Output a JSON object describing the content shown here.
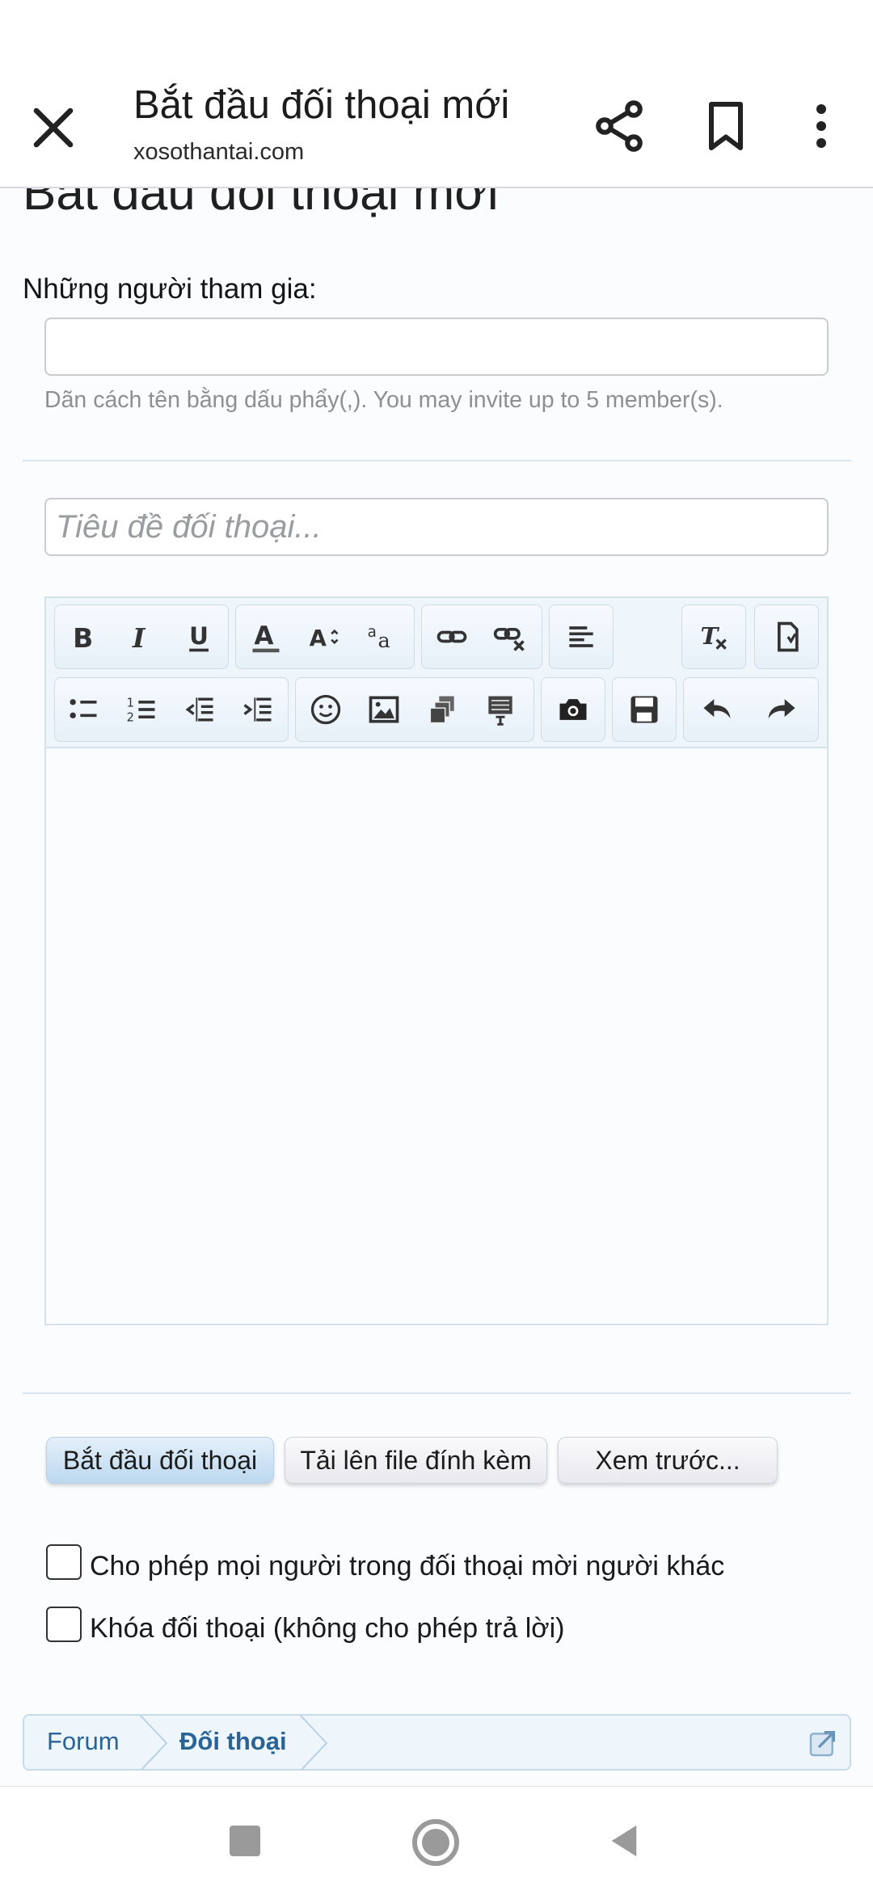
{
  "topbar": {
    "title": "Bắt đầu đối thoại mới",
    "url": "xosothantai.com"
  },
  "page": {
    "heading": "Bắt đầu đối thoại mới",
    "participants_label": "Những người tham gia:",
    "participants_value": "",
    "participants_hint": "Dãn cách tên bằng dấu phẩy(,). You may invite up to 5 member(s).",
    "title_placeholder": "Tiêu đề đối thoại...",
    "title_value": ""
  },
  "editor": {
    "toolbar_row1": [
      "bold-icon",
      "italic-icon",
      "underline-icon",
      "font-color-icon",
      "font-size-icon",
      "font-family-icon",
      "link-icon",
      "unlink-icon",
      "align-icon",
      "remove-format-icon",
      "paste-text-icon"
    ],
    "toolbar_row2": [
      "bullet-list-icon",
      "numbered-list-icon",
      "outdent-icon",
      "indent-icon",
      "smiley-icon",
      "image-icon",
      "media-icon",
      "quote-icon",
      "camera-icon",
      "save-draft-icon",
      "undo-icon",
      "redo-icon"
    ],
    "content": ""
  },
  "buttons": {
    "start": "Bắt đầu đối thoại",
    "upload": "Tải lên file đính kèm",
    "preview": "Xem trước..."
  },
  "options": {
    "allow_invite": "Cho phép mọi người trong đối thoại mời người khác",
    "lock": "Khóa đối thoại (không cho phép trả lời)"
  },
  "breadcrumb": [
    "Forum",
    "Đối thoại"
  ],
  "colors": {
    "link": "#2a6496",
    "toolbar_bg": "#eef5fb",
    "primary_button": "#bcd8ef"
  }
}
